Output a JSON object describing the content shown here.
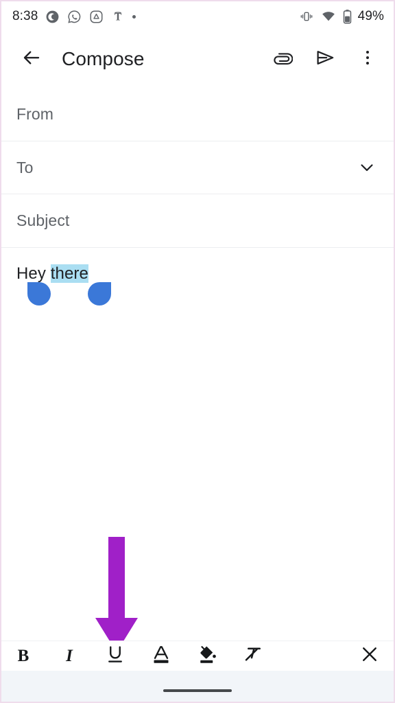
{
  "status_bar": {
    "clock": "8:38",
    "battery_percent": "49%",
    "left_icons": [
      {
        "name": "chrome-canary-icon",
        "label": "C"
      },
      {
        "name": "whatsapp-icon",
        "label": "WhatsApp"
      },
      {
        "name": "google-drive-icon",
        "label": "Drive"
      },
      {
        "name": "nytimes-icon",
        "label": "T"
      },
      {
        "name": "more-notifications-dot",
        "label": "•"
      }
    ],
    "right_icons": [
      {
        "name": "vibrate-icon",
        "label": "Vibrate"
      },
      {
        "name": "wifi-icon",
        "label": "Wi-Fi"
      },
      {
        "name": "battery-icon",
        "label": "Battery"
      }
    ]
  },
  "app_bar": {
    "back_label": "Back",
    "title": "Compose",
    "actions": [
      {
        "name": "attach-button",
        "label": "Attach file"
      },
      {
        "name": "send-button",
        "label": "Send"
      },
      {
        "name": "more-options-button",
        "label": "More options"
      }
    ]
  },
  "compose_form": {
    "from": {
      "label": "From",
      "value": "",
      "placeholder": "From"
    },
    "to": {
      "label": "To",
      "value": "",
      "placeholder": "To",
      "expand_label": "Show Cc/Bcc"
    },
    "subject": {
      "label": "Subject",
      "value": "",
      "placeholder": "Subject"
    },
    "body": {
      "text_before": "Hey ",
      "text_selected": "there",
      "text_after": "",
      "full_text": "Hey there",
      "selection_highlight_color": "#aadef2",
      "handle_color": "#3b78d8"
    }
  },
  "format_toolbar": {
    "items": [
      {
        "name": "bold-button",
        "label": "B"
      },
      {
        "name": "italic-button",
        "label": "I"
      },
      {
        "name": "underline-button",
        "label": "U"
      },
      {
        "name": "text-color-button",
        "label": "A"
      },
      {
        "name": "highlight-color-button",
        "label": "Fill"
      },
      {
        "name": "clear-formatting-button",
        "label": "Clear formatting"
      }
    ],
    "close_label": "Close formatting toolbar"
  },
  "annotation": {
    "arrow_color": "#A020C8",
    "points_to": "underline-button"
  },
  "nav_bar": {
    "home_indicator_label": "Home"
  }
}
